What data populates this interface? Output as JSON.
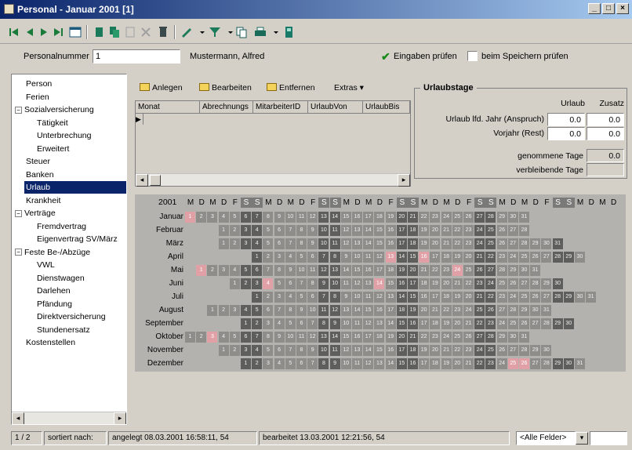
{
  "window": {
    "title": "Personal - Januar 2001 [1]",
    "min": "_",
    "max": "□",
    "close": "×"
  },
  "toolbar": {
    "icons": [
      "first-record-icon",
      "prev-record-icon",
      "next-record-icon",
      "last-record-icon",
      "form-icon",
      "new-icon",
      "copy-icon",
      "delete-icon",
      "cut-icon",
      "trash-icon",
      "edit-icon",
      "filter-icon",
      "copy-doc-icon",
      "print-icon",
      "exit-icon"
    ]
  },
  "person": {
    "label": "Personalnummer",
    "value": "1",
    "name": "Mustermann, Alfred",
    "check1": "Eingaben prüfen",
    "check2": "beim Speichern prüfen"
  },
  "tree": [
    {
      "label": "Person",
      "level": 0
    },
    {
      "label": "Ferien",
      "level": 0
    },
    {
      "label": "Sozialversicherung",
      "level": 0,
      "expander": "−"
    },
    {
      "label": "Tätigkeit",
      "level": 1
    },
    {
      "label": "Unterbrechung",
      "level": 1
    },
    {
      "label": "Erweitert",
      "level": 1
    },
    {
      "label": "Steuer",
      "level": 0
    },
    {
      "label": "Banken",
      "level": 0
    },
    {
      "label": "Urlaub",
      "level": 0,
      "selected": true
    },
    {
      "label": "Krankheit",
      "level": 0
    },
    {
      "label": "Verträge",
      "level": 0,
      "expander": "−"
    },
    {
      "label": "Fremdvertrag",
      "level": 1
    },
    {
      "label": "Eigenvertrag SV/März",
      "level": 1
    },
    {
      "label": "Feste Be-/Abzüge",
      "level": 0,
      "expander": "−"
    },
    {
      "label": "VWL",
      "level": 1
    },
    {
      "label": "Dienstwagen",
      "level": 1
    },
    {
      "label": "Darlehen",
      "level": 1
    },
    {
      "label": "Pfändung",
      "level": 1
    },
    {
      "label": "Direktversicherung",
      "level": 1
    },
    {
      "label": "Stundenersatz",
      "level": 1
    },
    {
      "label": "Kostenstellen",
      "level": 0
    }
  ],
  "list": {
    "buttons": [
      "Anlegen",
      "Bearbeiten",
      "Entfernen",
      "Extras ▾"
    ],
    "columns": [
      "Monat",
      "Abrechnungs",
      "MitarbeiterID",
      "UrlaubVon",
      "UrlaubBis"
    ]
  },
  "urlaub": {
    "title": "Urlaubstage",
    "col1": "Urlaub",
    "col2": "Zusatz",
    "row1": "Urlaub lfd. Jahr (Anspruch)",
    "row1v1": "0.0",
    "row1v2": "0.0",
    "row2": "Vorjahr (Rest)",
    "row2v1": "0.0",
    "row2v2": "0.0",
    "taken": "genommene Tage",
    "taken_v": "0.0",
    "remaining": "verbleibende Tage",
    "remaining_v": ""
  },
  "calendar": {
    "year": "2001",
    "dow": [
      "M",
      "D",
      "M",
      "D",
      "F",
      "S",
      "S"
    ],
    "months": [
      "Januar",
      "Februar",
      "März",
      "April",
      "Mai",
      "Juni",
      "Juli",
      "August",
      "September",
      "Oktober",
      "November",
      "Dezember"
    ],
    "start": [
      0,
      3,
      3,
      6,
      1,
      4,
      6,
      2,
      5,
      0,
      3,
      5
    ],
    "days": [
      31,
      28,
      31,
      30,
      31,
      30,
      31,
      31,
      30,
      31,
      30,
      31
    ],
    "holidays": [
      [
        1,
        1
      ],
      [
        4,
        13
      ],
      [
        4,
        16
      ],
      [
        5,
        1
      ],
      [
        5,
        24
      ],
      [
        6,
        4
      ],
      [
        6,
        14
      ],
      [
        10,
        3
      ],
      [
        12,
        25
      ],
      [
        12,
        26
      ]
    ]
  },
  "status": {
    "record": "1 / 2",
    "sort": "sortiert nach:",
    "created": "angelegt 08.03.2001 16:58:11, 54",
    "edited": "bearbeitet 13.03.2001 12:21:56, 54",
    "fields": "<Alle Felder>"
  }
}
